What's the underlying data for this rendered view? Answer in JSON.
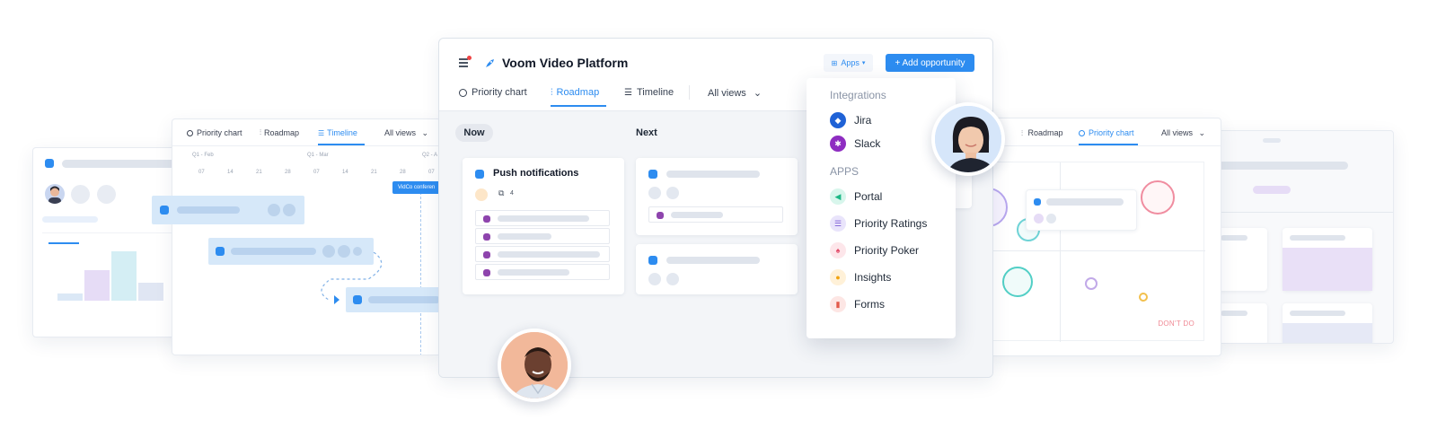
{
  "main": {
    "title": "Voom Video Platform",
    "tabs": [
      {
        "label": "Priority chart"
      },
      {
        "label": "Roadmap"
      },
      {
        "label": "Timeline"
      }
    ],
    "all_views": "All views",
    "apps_label": "Apps",
    "add_label": "+ Add opportunity",
    "columns": {
      "now": "Now",
      "next": "Next"
    },
    "card_title": "Push notifications",
    "card_count": "4",
    "accent": "#2d8cf0"
  },
  "dropdown": {
    "integrations_heading": "Integrations",
    "integrations": [
      {
        "label": "Jira",
        "icon": "jira-icon"
      },
      {
        "label": "Slack",
        "icon": "slack-icon"
      }
    ],
    "apps_heading": "APPS",
    "apps": [
      {
        "label": "Portal",
        "icon": "portal-icon"
      },
      {
        "label": "Priority Ratings",
        "icon": "priority-ratings-icon"
      },
      {
        "label": "Priority Poker",
        "icon": "priority-poker-icon"
      },
      {
        "label": "Insights",
        "icon": "insights-icon"
      },
      {
        "label": "Forms",
        "icon": "forms-icon"
      }
    ]
  },
  "timeline_panel": {
    "tabs": [
      {
        "label": "Priority chart"
      },
      {
        "label": "Roadmap"
      },
      {
        "label": "Timeline"
      }
    ],
    "all_views": "All views",
    "months": [
      "Q1 - Feb",
      "Q1 - Mar",
      "Q2 - A"
    ],
    "days": [
      "07",
      "14",
      "21",
      "28",
      "07",
      "14",
      "21",
      "28",
      "07"
    ],
    "tooltip": "VidCo conferen"
  },
  "chart_panel": {
    "tabs": [
      {
        "label": "Roadmap"
      },
      {
        "label": "Priority chart"
      }
    ],
    "all_views": "All views",
    "quadrant_label": "DON'T DO"
  }
}
